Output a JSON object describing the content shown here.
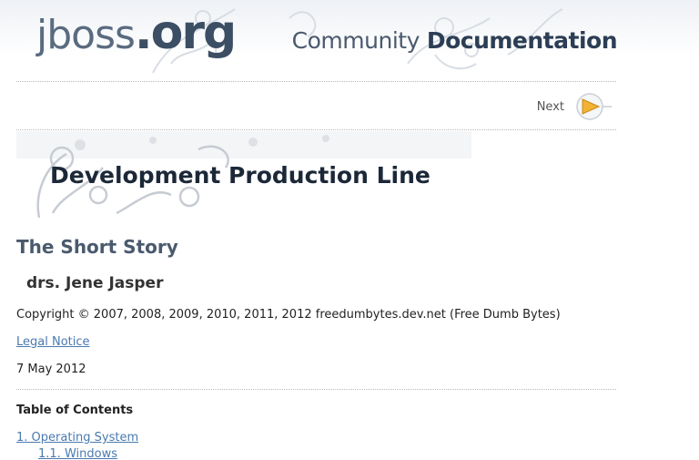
{
  "header": {
    "logo": "jboss.org",
    "logo_parts": [
      "jboss",
      ".org"
    ],
    "product_light": "Community",
    "product_bold": "Documentation"
  },
  "nav": {
    "next_label": "Next"
  },
  "document": {
    "title": "Development Production Line",
    "subtitle": "The Short Story",
    "author": "drs. Jene Jasper",
    "copyright": "Copyright © 2007, 2008, 2009, 2010, 2011, 2012 freedumbytes.dev.net (Free Dumb Bytes)",
    "legal_notice": "Legal Notice",
    "pubdate": "7 May 2012"
  },
  "toc": {
    "heading": "Table of Contents",
    "items": [
      {
        "label": "1. Operating System"
      },
      {
        "label": "1.1. Windows"
      }
    ]
  },
  "colors": {
    "link": "#4a7ab0",
    "title": "#1c2838",
    "subtitle": "#4a5a6e"
  }
}
